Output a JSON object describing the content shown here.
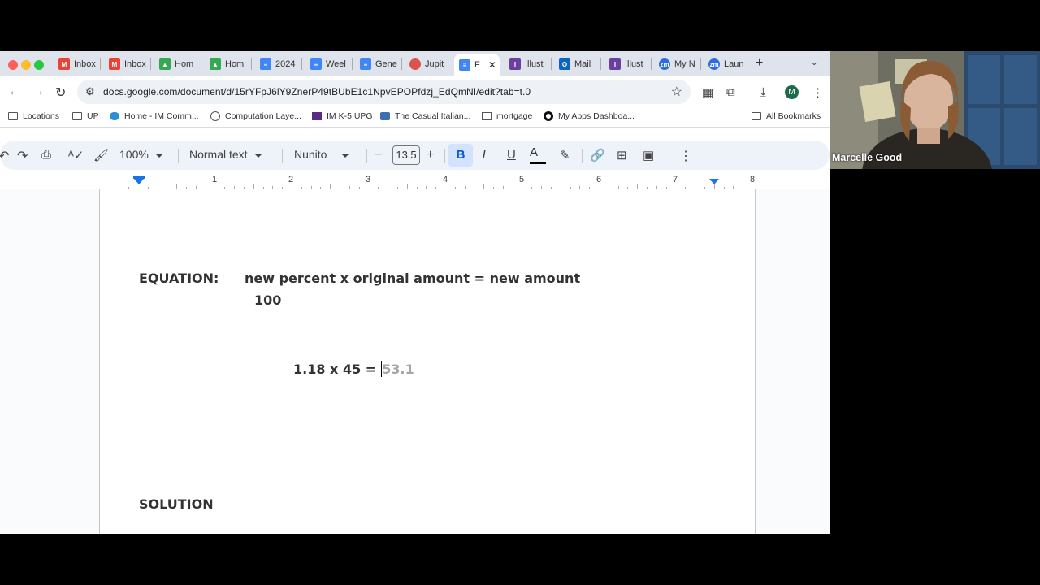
{
  "browser": {
    "tabs": [
      {
        "label": "Inbox",
        "icon": "gmail-icon",
        "color": "#ea4335"
      },
      {
        "label": "Inbox",
        "icon": "gmail-icon",
        "color": "#ea4335"
      },
      {
        "label": "Hom",
        "icon": "google-drive-icon",
        "color": "#34a853"
      },
      {
        "label": "Hom",
        "icon": "google-drive-icon",
        "color": "#34a853"
      },
      {
        "label": "2024",
        "icon": "google-docs-icon",
        "color": "#4285f4"
      },
      {
        "label": "Weel",
        "icon": "google-docs-icon",
        "color": "#4285f4"
      },
      {
        "label": "Gene",
        "icon": "google-docs-icon",
        "color": "#4285f4"
      },
      {
        "label": "Jupit",
        "icon": "jupiter-icon",
        "color": "#d9534f"
      },
      {
        "label": "F",
        "icon": "google-docs-icon",
        "color": "#4285f4",
        "active": true
      },
      {
        "label": "Illust",
        "icon": "illustrative-math-icon",
        "color": "#6b3fa0"
      },
      {
        "label": "Mail",
        "icon": "outlook-icon",
        "color": "#0a64c2"
      },
      {
        "label": "Illust",
        "icon": "illustrative-math-icon",
        "color": "#6b3fa0"
      },
      {
        "label": "My N",
        "icon": "zoom-icon",
        "color": "#2d6cdf"
      },
      {
        "label": "Laun",
        "icon": "zoom-icon",
        "color": "#2d6cdf"
      }
    ],
    "url": "docs.google.com/document/d/15rYFpJ6lY9ZnerP49tBUbE1c1NpvEPOPfdzj_EdQmNI/edit?tab=t.0",
    "profile_initial": "M",
    "bookmarks": [
      {
        "label": "Locations",
        "icon": "folder-icon"
      },
      {
        "label": "UP",
        "icon": "folder-icon"
      },
      {
        "label": "Home - IM Comm...",
        "icon": "cloud-icon"
      },
      {
        "label": "Computation Laye...",
        "icon": "globe-icon"
      },
      {
        "label": "IM K-5 UPG",
        "icon": "calendar-icon"
      },
      {
        "label": "The Casual Italian...",
        "icon": "bird-icon"
      },
      {
        "label": "mortgage",
        "icon": "house-icon"
      },
      {
        "label": "My Apps Dashboa...",
        "icon": "okta-icon"
      }
    ],
    "all_bookmarks": "All Bookmarks"
  },
  "toolbar": {
    "zoom": "100%",
    "style": "Normal text",
    "font": "Nunito",
    "font_size": "13.5",
    "bold": "B",
    "italic": "I",
    "underline": "U",
    "text_color": "A"
  },
  "ruler": {
    "numbers": [
      "1",
      "2",
      "3",
      "4",
      "5",
      "6",
      "7",
      "8"
    ]
  },
  "document": {
    "equation_label": "EQUATION:",
    "fraction_numerator": "new percent ",
    "equation_rest": " x original amount = new amount",
    "fraction_denominator": "100",
    "calc_text": "1.18 x 45 = ",
    "calc_suggestion": "53.1",
    "solution_label": "SOLUTION"
  },
  "webcam": {
    "participant_name": "Marcelle Good"
  }
}
